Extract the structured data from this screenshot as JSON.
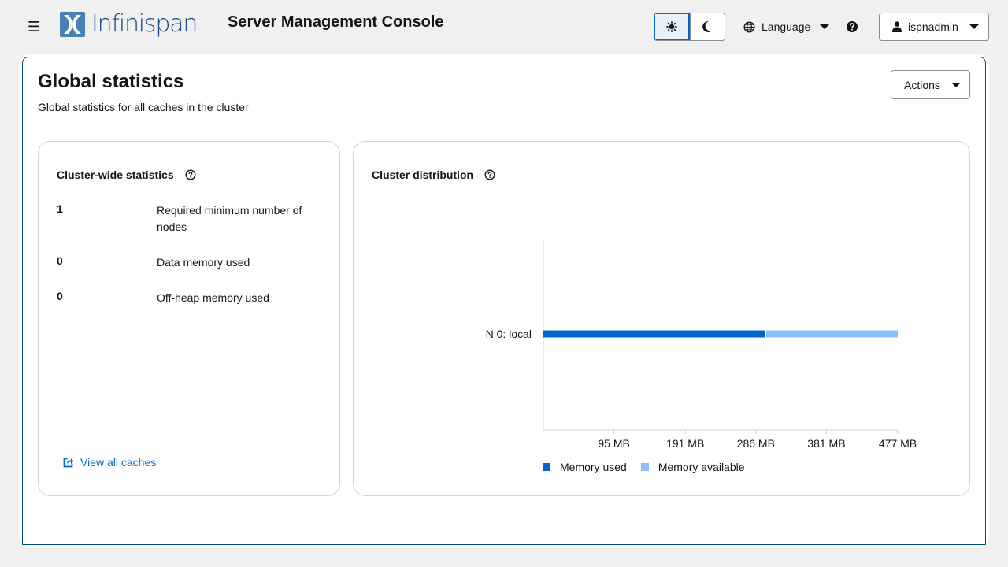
{
  "header": {
    "logo_text": "Infinispan",
    "app_title": "Server Management Console",
    "language_label": "Language",
    "user_label": "ispnadmin"
  },
  "page": {
    "title": "Global statistics",
    "subtitle": "Global statistics for all caches in the cluster",
    "actions_label": "Actions"
  },
  "cluster_stats": {
    "title": "Cluster-wide statistics",
    "rows": [
      {
        "value": "1",
        "label": "Required minimum number of nodes"
      },
      {
        "value": "0",
        "label": "Data memory used"
      },
      {
        "value": "0",
        "label": "Off-heap memory used"
      }
    ],
    "view_all_label": "View all caches"
  },
  "distribution": {
    "title": "Cluster distribution"
  },
  "chart_data": {
    "type": "bar",
    "orientation": "horizontal",
    "stacked": true,
    "categories": [
      "N 0: local"
    ],
    "series": [
      {
        "name": "Memory used",
        "values": [
          300
        ],
        "color": "#0066cc"
      },
      {
        "name": "Memory available",
        "values": [
          177
        ],
        "color": "#8bc1f7"
      }
    ],
    "xticks": [
      "95 MB",
      "191 MB",
      "286 MB",
      "381 MB",
      "477 MB"
    ],
    "xtick_values": [
      95,
      191,
      286,
      381,
      477
    ],
    "xlim": [
      0,
      477
    ],
    "legend_position": "bottom-left",
    "grid": false
  },
  "colors": {
    "accent": "#0066cc",
    "brand": "#1c4a80",
    "panel_border": "#004a7f"
  }
}
